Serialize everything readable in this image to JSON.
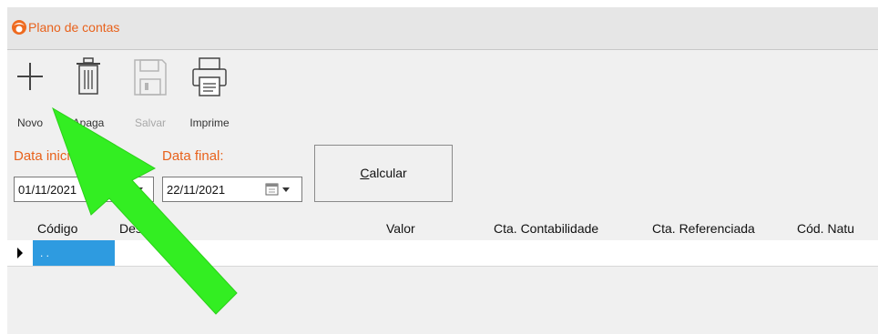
{
  "window": {
    "title": "Plano de contas"
  },
  "toolbar": {
    "novo": "Novo",
    "apaga": "Apaga",
    "salvar": "Salvar",
    "imprime": "Imprime"
  },
  "filters": {
    "data_inicial_label": "Data inicial:",
    "data_inicial_value": "01/11/2021",
    "data_final_label": "Data final:",
    "data_final_value": "22/11/2021",
    "calcular_accel": "C",
    "calcular_rest": "alcular"
  },
  "grid": {
    "columns": [
      "Código",
      "Descrição",
      "Valor",
      "Cta. Contabilidade",
      "Cta. Referenciada",
      "Cód. Natu"
    ],
    "rows": [
      {
        "codigo": ". .",
        "descricao": "",
        "valor": "",
        "cta_contabilidade": "",
        "cta_referenciada": "",
        "cod_natureza": ""
      }
    ]
  },
  "colors": {
    "accent": "#e8621c",
    "selection": "#2e9be0",
    "annotation_arrow": "#33ee22"
  },
  "icons": [
    "app-logo-icon",
    "plus-icon",
    "trash-icon",
    "floppy-disk-icon",
    "printer-icon",
    "calendar-icon",
    "dropdown-arrow-icon",
    "row-indicator-icon"
  ]
}
